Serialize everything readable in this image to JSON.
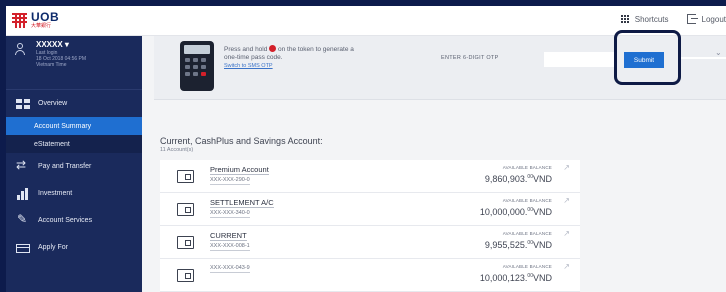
{
  "header": {
    "logo_name": "UOB",
    "logo_sub": "大華銀行",
    "shortcuts_label": "Shortcuts",
    "logout_label": "Logout"
  },
  "user": {
    "name": "XXXXX ▾",
    "last_login_label": "Last login",
    "last_login_date": "18 Oct 2018 04:56 PM",
    "timezone": "Vietnam Time"
  },
  "sidebar": {
    "items": [
      {
        "label": "Overview",
        "icon": "overview-icon"
      },
      {
        "label": "Account Summary"
      },
      {
        "label": "eStatement"
      },
      {
        "label": "Pay and Transfer",
        "icon": "transfer-icon"
      },
      {
        "label": "Investment",
        "icon": "investment-icon"
      },
      {
        "label": "Account Services",
        "icon": "pencil-icon"
      },
      {
        "label": "Apply For",
        "icon": "card-icon"
      }
    ]
  },
  "otp": {
    "instruction": "Press and hold",
    "instruction_rest": "on the token to generate a one-time pass code.",
    "switch_link": "Switch to SMS OTP",
    "field_label": "ENTER 6-DIGIT OTP",
    "input_value": "",
    "submit_label": "Submit"
  },
  "accounts_section": {
    "title": "Current, CashPlus and Savings Account:",
    "count": "11 Account(s)",
    "balance_label": "AVAILABLE BALANCE",
    "rows": [
      {
        "name": "Premium Account",
        "number": "XXX-XXX-290-0",
        "balance": "9,860,903.",
        "decimals": "00",
        "currency": "VND"
      },
      {
        "name": "SETTLEMENT A/C",
        "number": "XXX-XXX-340-0",
        "balance": "10,000,000.",
        "decimals": "00",
        "currency": "VND"
      },
      {
        "name": "CURRENT",
        "number": "XXX-XXX-008-1",
        "balance": "9,955,525.",
        "decimals": "00",
        "currency": "VND"
      },
      {
        "name": "",
        "number": "XXX-XXX-043-9",
        "balance": "10,000,123.",
        "decimals": "00",
        "currency": "VND"
      }
    ]
  },
  "colors": {
    "sidebar_bg": "#1a2a5c",
    "active_item": "#1f6fd1",
    "brand_red": "#d3202a",
    "highlight_ring": "#0e1a45"
  }
}
